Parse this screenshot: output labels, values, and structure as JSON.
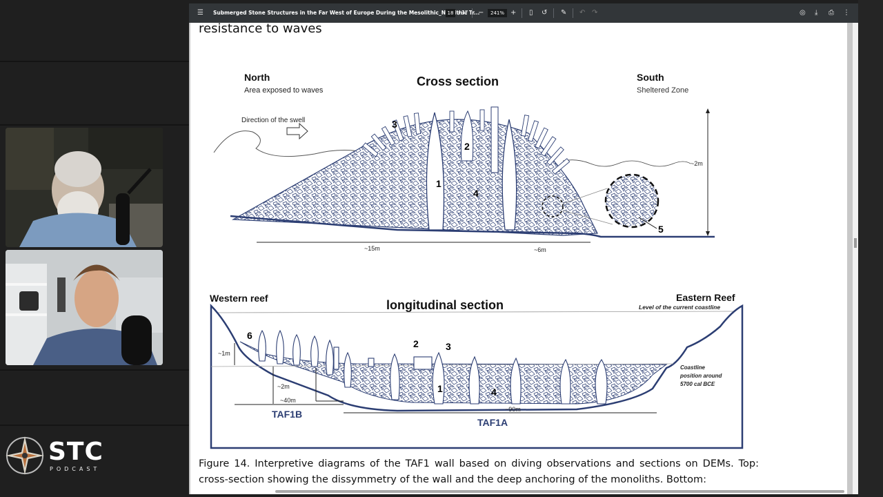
{
  "viewer": {
    "doc_title": "Submerged Stone Structures in the Far West of Europe During the Mesolithic_Neolithic Tr...",
    "page_current": "18",
    "page_total": "/ 37",
    "zoom": "241%",
    "icons": [
      "menu-icon",
      "zoom-out-icon",
      "zoom-in-icon",
      "fit-page-icon",
      "rotate-icon",
      "draw-icon",
      "undo-icon",
      "redo-icon",
      "edit-icon",
      "download-icon",
      "print-icon",
      "more-icon"
    ]
  },
  "page": {
    "heading_fragment": "resistance to waves",
    "caption": "Figure 14. Interpretive diagrams of the TAF1 wall based on diving observations and sections on DEMs. Top: cross-section showing the dissymmetry of the wall and the deep anchoring of the monoliths. Bottom:"
  },
  "cross_section": {
    "title": "Cross section",
    "north": "North",
    "north_sub": "Area exposed to waves",
    "south": "South",
    "south_sub": "Sheltered Zone",
    "swell": "Direction of the swell",
    "height": "~2m",
    "width_left": "~15m",
    "width_right": "~6m",
    "labels": [
      "1",
      "2",
      "3",
      "4",
      "5"
    ]
  },
  "longitudinal_section": {
    "title": "longitudinal section",
    "western": "Western reef",
    "eastern": "Eastern Reef",
    "coastline": "Level of the current coastline",
    "old_coast_1": "Coastline",
    "old_coast_2": "position around",
    "old_coast_3": "5700 cal BCE",
    "depth_1m": "~1m",
    "depth_2m": "~2m",
    "len_40": "~40m",
    "len_90": "~90m",
    "taf1b": "TAF1B",
    "taf1a": "TAF1A",
    "labels": [
      "6",
      "2",
      "3",
      "1",
      "4"
    ]
  },
  "podcast": {
    "logo": "STC",
    "logo_sub": "PODCAST"
  }
}
